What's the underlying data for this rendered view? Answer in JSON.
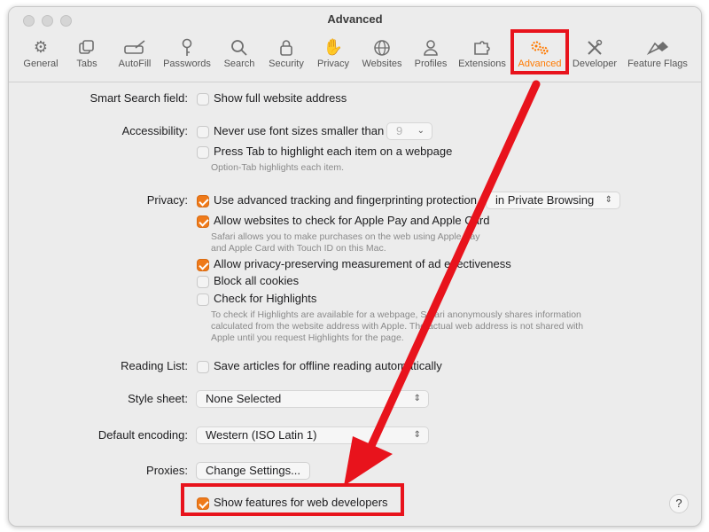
{
  "window": {
    "title": "Advanced"
  },
  "toolbar": {
    "items": [
      {
        "label": "General",
        "icon": "gear-icon"
      },
      {
        "label": "Tabs",
        "icon": "tabs-icon"
      },
      {
        "label": "AutoFill",
        "icon": "autofill-icon"
      },
      {
        "label": "Passwords",
        "icon": "key-icon"
      },
      {
        "label": "Search",
        "icon": "search-icon"
      },
      {
        "label": "Security",
        "icon": "lock-icon"
      },
      {
        "label": "Privacy",
        "icon": "hand-icon"
      },
      {
        "label": "Websites",
        "icon": "globe-icon"
      },
      {
        "label": "Profiles",
        "icon": "person-icon"
      },
      {
        "label": "Extensions",
        "icon": "puzzle-icon"
      },
      {
        "label": "Advanced",
        "icon": "advanced-gears-icon",
        "active": true
      },
      {
        "label": "Developer",
        "icon": "tools-icon"
      },
      {
        "label": "Feature Flags",
        "icon": "flags-icon"
      }
    ],
    "accent_color": "#ff7a00"
  },
  "smart_search": {
    "label": "Smart Search field:",
    "option": "Show full website address",
    "checked": false
  },
  "accessibility": {
    "label": "Accessibility:",
    "option_font": "Never use font sizes smaller than",
    "font_size_value": "9",
    "option_tab": "Press Tab to highlight each item on a webpage",
    "hint": "Option-Tab highlights each item."
  },
  "privacy": {
    "label": "Privacy:",
    "option_tracking": "Use advanced tracking and fingerprinting protection",
    "tracking_scope": "in Private Browsing",
    "option_applepay": "Allow websites to check for Apple Pay and Apple Card",
    "applepay_hint_1": "Safari allows you to make purchases on the web using Apple Pay",
    "applepay_hint_2": "and Apple Card with Touch ID on this Mac.",
    "option_measurement": "Allow privacy-preserving measurement of ad effectiveness",
    "option_cookies": "Block all cookies",
    "option_highlights": "Check for Highlights",
    "highlights_hint_1": "To check if Highlights are available for a webpage, Safari anonymously shares information",
    "highlights_hint_2": "calculated from the website address with Apple. The actual web address is not shared with",
    "highlights_hint_3": "Apple until you request Highlights for the page."
  },
  "reading_list": {
    "label": "Reading List:",
    "option": "Save articles for offline reading automatically"
  },
  "style_sheet": {
    "label": "Style sheet:",
    "value": "None Selected"
  },
  "encoding": {
    "label": "Default encoding:",
    "value": "Western (ISO Latin 1)"
  },
  "proxies": {
    "label": "Proxies:",
    "button": "Change Settings..."
  },
  "developer": {
    "option": "Show features for web developers",
    "checked": true
  },
  "help": {
    "label": "?"
  },
  "annotation": {
    "color": "#e8131c"
  }
}
